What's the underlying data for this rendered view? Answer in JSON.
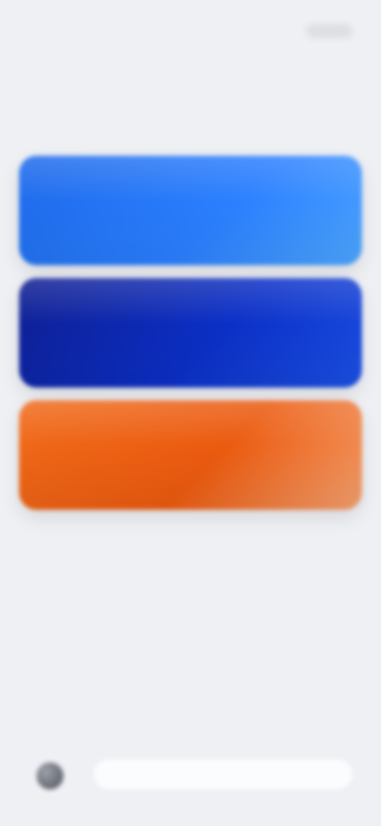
{
  "header": {
    "title": "",
    "action_label": ""
  },
  "section": {
    "label": ""
  },
  "cards": [
    {
      "label": "",
      "color_start": "#1d69ea",
      "color_end": "#4da6ff"
    },
    {
      "label": "",
      "color_start": "#0f1d8f",
      "color_end": "#1b50e5"
    },
    {
      "label": "",
      "color_start": "#f06a1a",
      "color_end": "#f4a06e"
    }
  ],
  "footer": {
    "avatar_icon": "avatar-icon",
    "input_placeholder": "",
    "input_value": ""
  },
  "colors": {
    "background": "#eef0f4",
    "title_text": "#121212",
    "secondary_text": "#6f7481",
    "card_blue": "#2b7fff",
    "card_navy": "#0b2fc6",
    "card_orange": "#eb5a0f"
  }
}
